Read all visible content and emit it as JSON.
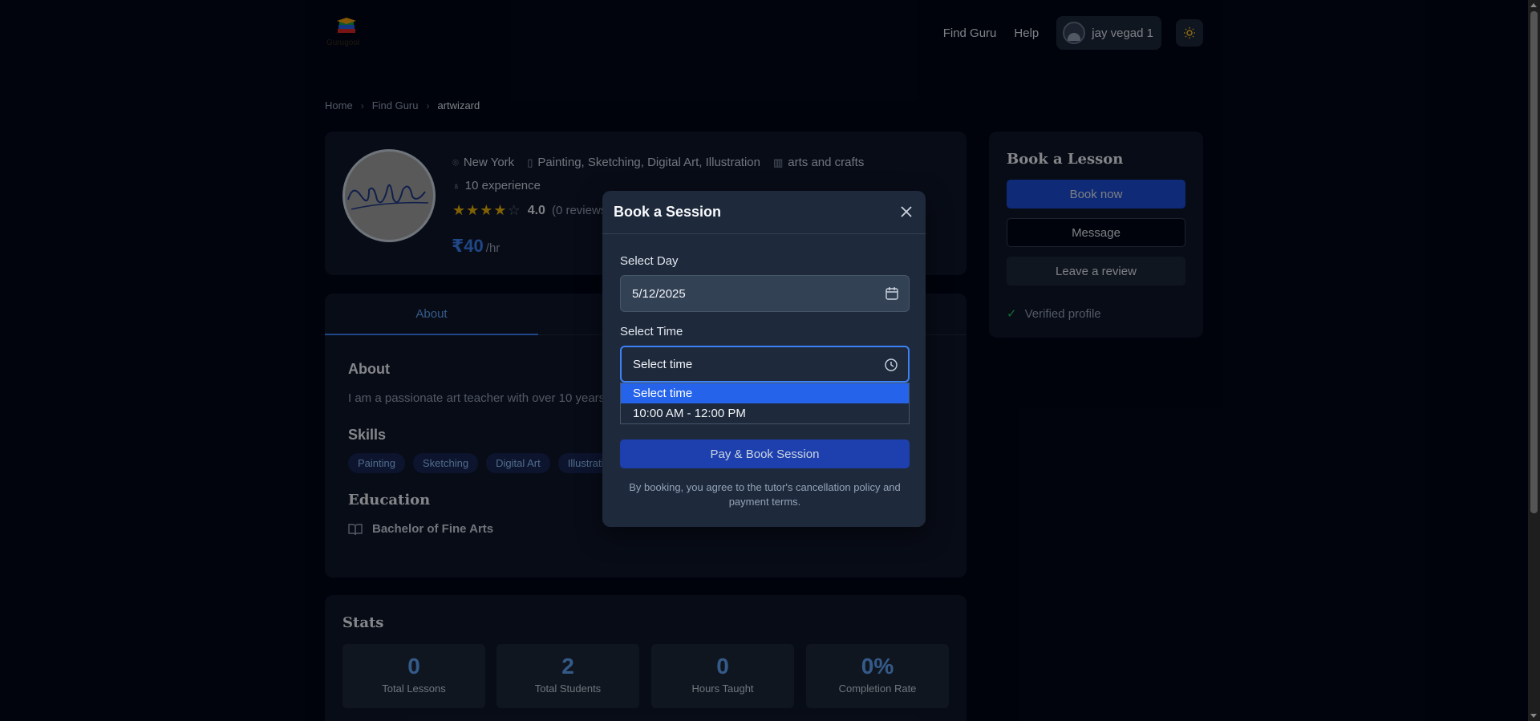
{
  "header": {
    "logo_text": "Gurugool",
    "nav": [
      "Find Guru",
      "Help"
    ],
    "user_name": "jay vegad 1"
  },
  "breadcrumb": [
    "Home",
    "Find Guru",
    "artwizard"
  ],
  "profile": {
    "location": "New York",
    "subjects": "Painting, Sketching, Digital Art, Illustration",
    "category": "arts and crafts",
    "experience": "10 experience",
    "rating_value": 4.0,
    "rating_text": "4.0",
    "reviews": "(0 reviews)",
    "price": "₹40",
    "price_unit": "/hr"
  },
  "tabs": [
    "About"
  ],
  "about": {
    "heading": "About",
    "text": "I am a passionate art teacher with over 10 years",
    "skills_heading": "Skills",
    "skills": [
      "Painting",
      "Sketching",
      "Digital Art",
      "Illustration"
    ],
    "education_heading": "Education",
    "education": "Bachelor of Fine Arts"
  },
  "stats": {
    "heading": "Stats",
    "items": [
      {
        "value": "0",
        "label": "Total Lessons"
      },
      {
        "value": "2",
        "label": "Total Students"
      },
      {
        "value": "0",
        "label": "Hours Taught"
      },
      {
        "value": "0%",
        "label": "Completion Rate"
      }
    ]
  },
  "sidebar": {
    "title": "Book a Lesson",
    "book_now": "Book now",
    "message": "Message",
    "leave_review": "Leave a review",
    "verified": "Verified profile"
  },
  "modal": {
    "title": "Book a Session",
    "day_label": "Select Day",
    "day_value": "5/12/2025",
    "time_label": "Select Time",
    "time_value": "Select time",
    "time_options": [
      "Select time",
      "10:00 AM - 12:00 PM"
    ],
    "pay_button": "Pay & Book Session",
    "policy": "By booking, you agree to the tutor's cancellation policy and payment terms."
  },
  "colors": {
    "background": "#020617",
    "card": "#0f172a",
    "accent": "#3b82f6",
    "primary_button": "#1d4ed8",
    "star": "#eab308",
    "verified": "#22c55e"
  }
}
